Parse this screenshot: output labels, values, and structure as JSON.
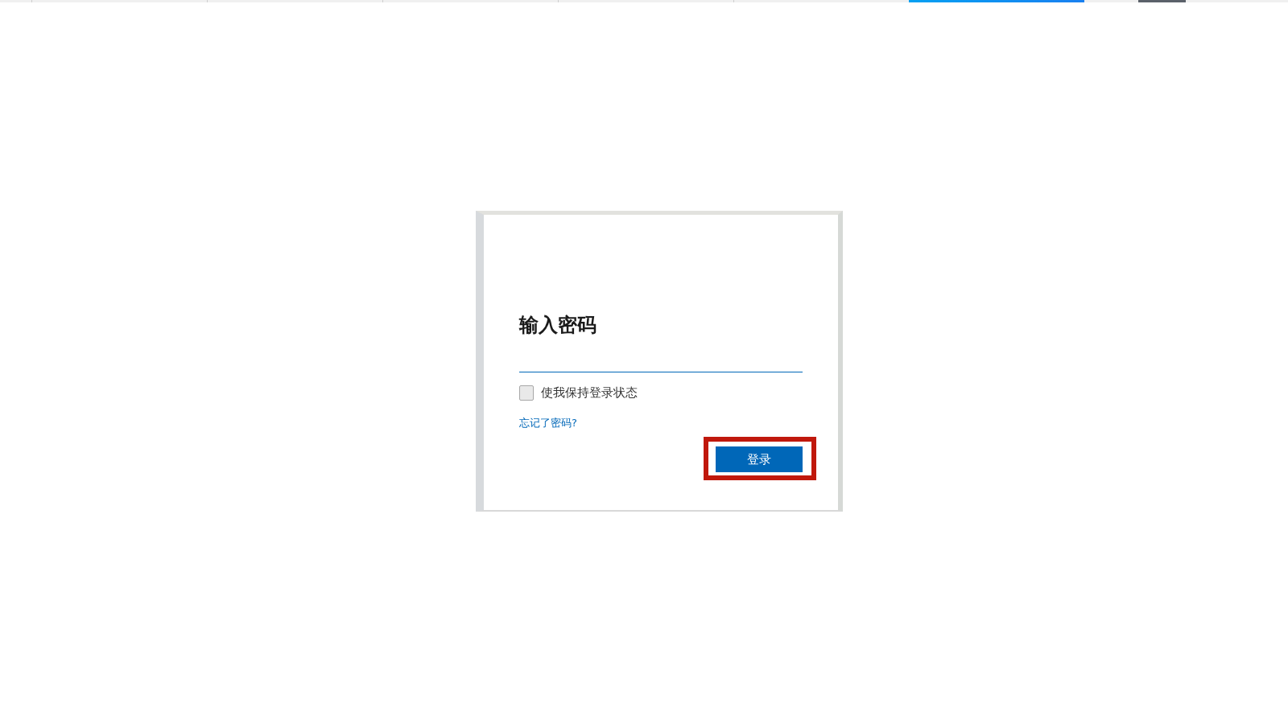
{
  "top_strip": {
    "tabs": [
      {
        "selected": false
      },
      {
        "selected": false
      },
      {
        "selected": false
      },
      {
        "selected": false
      },
      {
        "selected": false
      },
      {
        "selected": true
      }
    ]
  },
  "sign_in": {
    "title": "输入密码",
    "password_field": {
      "focused": true
    },
    "keep_signed_in": {
      "label": "使我保持登录状态",
      "checked": false
    },
    "forgot_password_link": "忘记了密码?",
    "sign_in_button": {
      "label": "登录",
      "highlighted": true
    }
  }
}
